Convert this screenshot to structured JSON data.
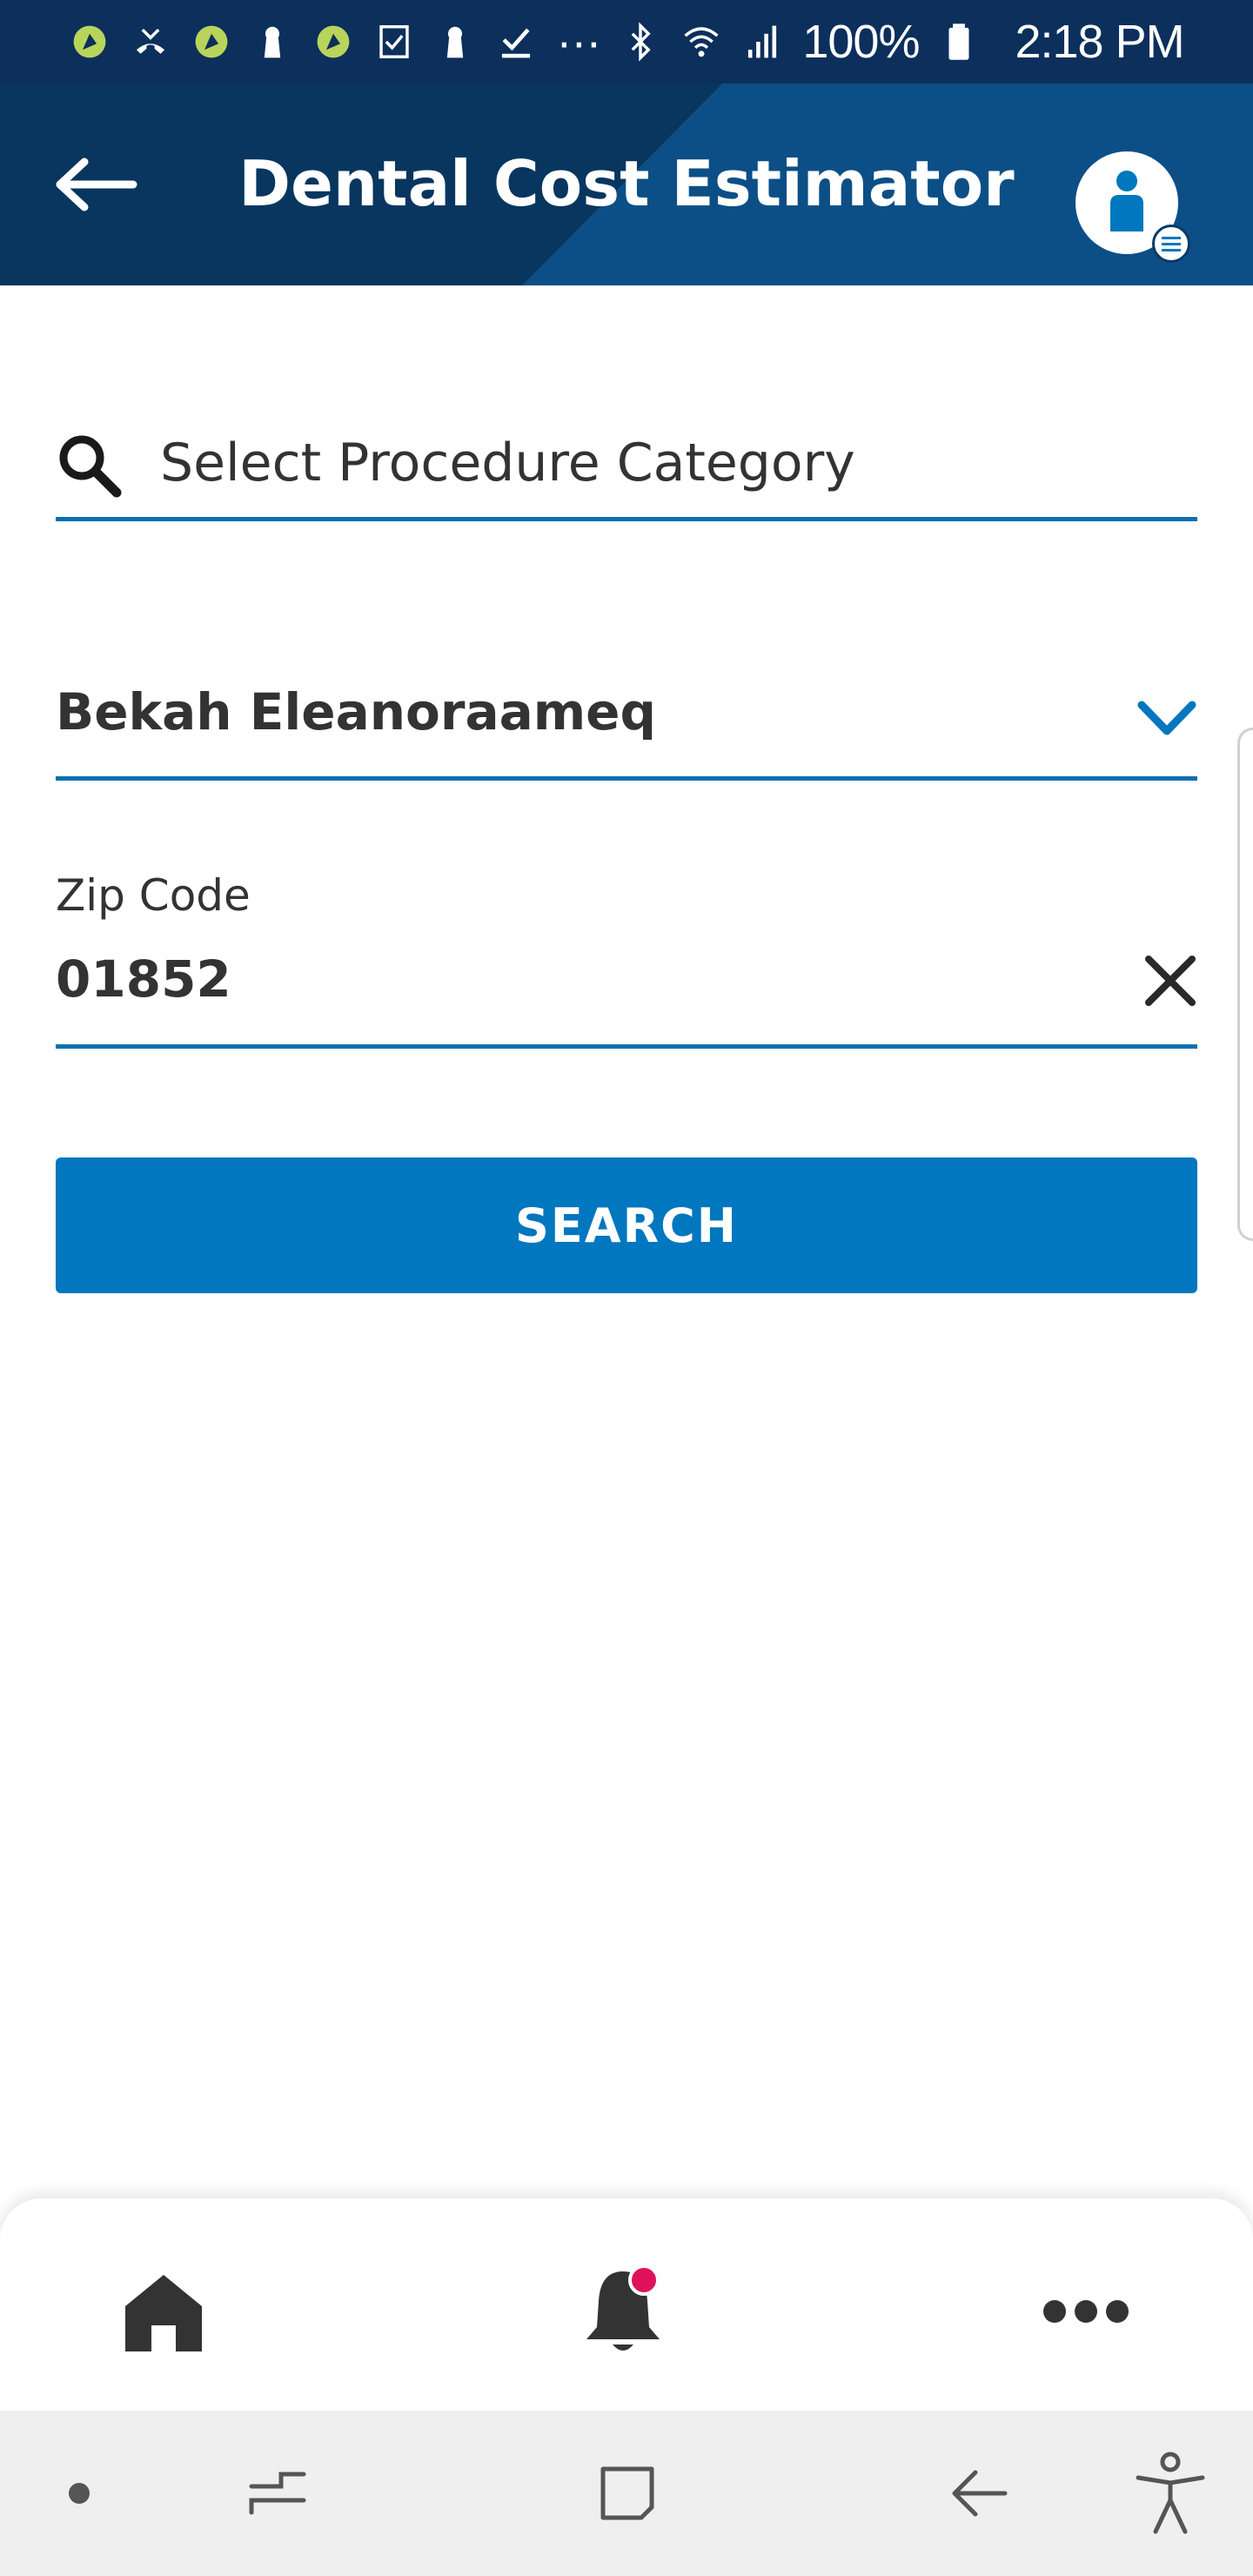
{
  "status_bar": {
    "battery": "100%",
    "time": "2:18 PM",
    "icons": [
      "app-notification-icon",
      "missed-call-icon",
      "app-notification-icon",
      "keyhole-icon",
      "app-notification-icon",
      "checkbox-icon",
      "keyhole-icon",
      "download-done-icon",
      "more-dots",
      "bluetooth-icon",
      "wifi-icon",
      "signal-icon",
      "battery-icon"
    ],
    "more_glyph": "···"
  },
  "header": {
    "title": "Dental Cost Estimator",
    "colors": {
      "background": "#0a3a66",
      "accent": "#0c4f86"
    }
  },
  "form": {
    "procedure_search": {
      "placeholder": "Select Procedure Category",
      "value": ""
    },
    "member": {
      "selected": "Bekah Eleanoraameq"
    },
    "zip": {
      "label": "Zip Code",
      "value": "01852"
    },
    "search_button": "SEARCH"
  },
  "tab_bar": {
    "items": [
      "home-icon",
      "notifications-bell-icon",
      "more-horizontal-icon"
    ],
    "notification_badge_color": "#e0125a"
  },
  "nav_bar": {
    "items": [
      "dot-indicator",
      "recent-apps-icon",
      "home-square-icon",
      "back-arrow-icon",
      "accessibility-icon"
    ]
  },
  "colors": {
    "primary": "#0077be",
    "underline": "#0a70b0",
    "text": "#333333"
  }
}
